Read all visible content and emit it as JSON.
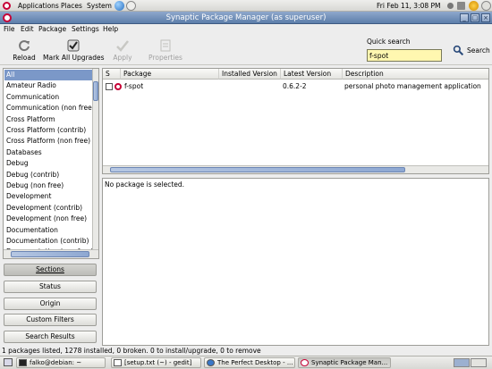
{
  "top_panel": {
    "menus": [
      "Applications",
      "Places",
      "System"
    ],
    "clock": "Fri Feb 11,  3:08 PM"
  },
  "window": {
    "title": "Synaptic Package Manager  (as superuser)",
    "menu": [
      "File",
      "Edit",
      "Package",
      "Settings",
      "Help"
    ]
  },
  "toolbar": {
    "reload": "Reload",
    "mark_all": "Mark All Upgrades",
    "apply": "Apply",
    "properties": "Properties"
  },
  "quick_search": {
    "label": "Quick search",
    "value": "f-spot",
    "button": "Search"
  },
  "categories": [
    "All",
    "Amateur Radio",
    "Communication",
    "Communication (non free)",
    "Cross Platform",
    "Cross Platform (contrib)",
    "Cross Platform (non free)",
    "Databases",
    "Debug",
    "Debug (contrib)",
    "Debug (non free)",
    "Development",
    "Development (contrib)",
    "Development (non free)",
    "Documentation",
    "Documentation (contrib)",
    "Documentation (non free)"
  ],
  "filter_buttons": [
    "Sections",
    "Status",
    "Origin",
    "Custom Filters",
    "Search Results"
  ],
  "package_table": {
    "columns": [
      "S",
      "Package",
      "Installed Version",
      "Latest Version",
      "Description"
    ],
    "rows": [
      {
        "package": "f-spot",
        "installed": "",
        "latest": "0.6.2-2",
        "description": "personal photo management application"
      }
    ]
  },
  "description_panel": {
    "text": "No package is selected."
  },
  "status_bar": "1 packages listed, 1278 installed, 0 broken. 0 to install/upgrade, 0 to remove",
  "taskbar": [
    "falko@debian: ~",
    "[setup.txt (~) - gedit]",
    "The Perfect Desktop - ...",
    "Synaptic Package Man..."
  ],
  "colors": {
    "title_bar": "#6f8db8",
    "selection": "#7b98c8",
    "search_field": "#fff7b0"
  }
}
